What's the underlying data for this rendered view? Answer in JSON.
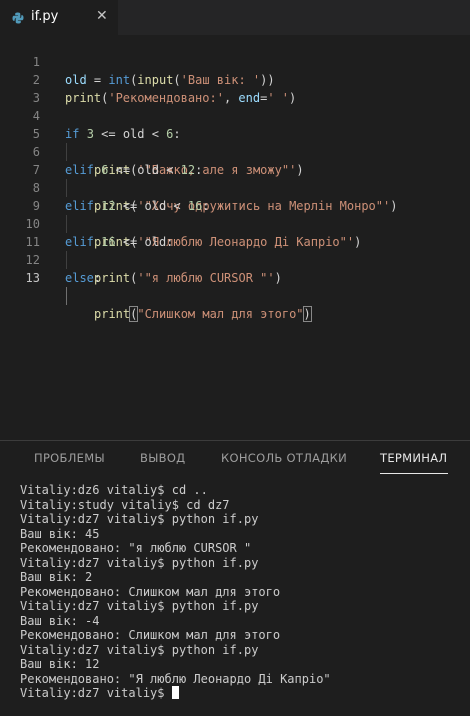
{
  "tab": {
    "title": "if.py",
    "close": "✕",
    "icon": "python-icon"
  },
  "editor": {
    "lines": [
      {
        "num": "1"
      },
      {
        "num": "2"
      },
      {
        "num": "3"
      },
      {
        "num": "4"
      },
      {
        "num": "5"
      },
      {
        "num": "6"
      },
      {
        "num": "7"
      },
      {
        "num": "8"
      },
      {
        "num": "9"
      },
      {
        "num": "10"
      },
      {
        "num": "11"
      },
      {
        "num": "12"
      },
      {
        "num": "13"
      }
    ],
    "code": {
      "l1": {
        "a": "old",
        "b": " = ",
        "c": "int",
        "d": "(",
        "e": "input",
        "f": "(",
        "g": "'Ваш вік: '",
        "h": "))"
      },
      "l2": {
        "a": "print",
        "b": "(",
        "c": "'Рекомендовано:'",
        "d": ", ",
        "e": "end",
        "f": "=",
        "g": "' '",
        "h": ")"
      },
      "l4": {
        "a": "if",
        "b": " ",
        "c": "3",
        "d": " <= old < ",
        "e": "6",
        "f": ":"
      },
      "l5": {
        "a": "print",
        "b": "(",
        "c": "'\"Важко, але я зможу\"'",
        "d": ")"
      },
      "l6": {
        "a": "elif",
        "b": " ",
        "c": "6",
        "d": " <= old < ",
        "e": "12",
        "f": ":"
      },
      "l7": {
        "a": "print",
        "b": "(",
        "c": "'\"Хочу одружитись на Мерлін Монро\"'",
        "d": ")"
      },
      "l8": {
        "a": "elif",
        "b": " ",
        "c": "12",
        "d": " <= old < ",
        "e": "16",
        "f": ":"
      },
      "l9": {
        "a": "print",
        "b": "(",
        "c": "'\"Я люблю Леонардо Ді Капріо\"'",
        "d": ")"
      },
      "l10": {
        "a": "elif",
        "b": " ",
        "c": "16",
        "d": " <= old:"
      },
      "l11": {
        "a": "print",
        "b": "(",
        "c": "'\"я люблю CURSOR \"'",
        "d": ")"
      },
      "l12": {
        "a": "else",
        "b": ":"
      },
      "l13": {
        "a": "print",
        "b": "(",
        "c": "\"Слишком мал для этого\"",
        "d": ")"
      }
    }
  },
  "panel": {
    "tabs": {
      "problems": "ПРОБЛЕМЫ",
      "output": "ВЫВОД",
      "debug": "КОНСОЛЬ ОТЛАДКИ",
      "terminal": "ТЕРМИНАЛ"
    },
    "terminal_lines": [
      "Vitaliy:dz6 vitaliy$ cd ..",
      "Vitaliy:study vitaliy$ cd dz7",
      "Vitaliy:dz7 vitaliy$ python if.py",
      "Ваш вік: 45",
      "Рекомендовано: \"я люблю CURSOR \"",
      "Vitaliy:dz7 vitaliy$ python if.py",
      "Ваш вік: 2",
      "Рекомендовано: Слишком мал для этого",
      "Vitaliy:dz7 vitaliy$ python if.py",
      "Ваш вік: -4",
      "Рекомендовано: Слишком мал для этого",
      "Vitaliy:dz7 vitaliy$ python if.py",
      "Ваш вік: 12",
      "Рекомендовано: \"Я люблю Леонардо Ді Капріо\""
    ],
    "prompt": "Vitaliy:dz7 vitaliy$ "
  }
}
